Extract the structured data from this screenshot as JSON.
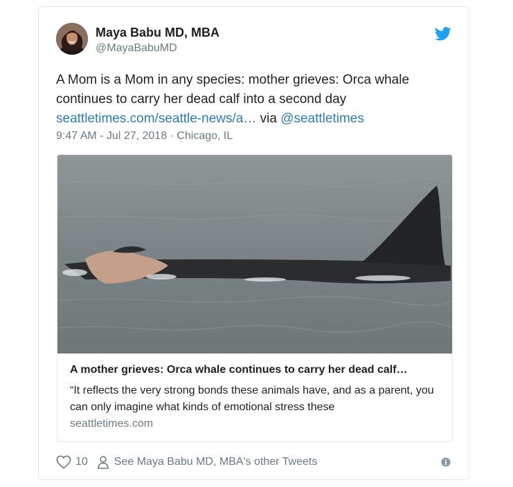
{
  "author": {
    "display_name": "Maya Babu MD, MBA",
    "handle": "@MayaBabuMD"
  },
  "tweet": {
    "text": "A Mom is a Mom in any species: mother grieves: Orca whale continues to carry her dead calf into a second day",
    "link": "seattletimes.com/seattle-news/a…",
    "via_label": "via",
    "mention": "@seattletimes",
    "timestamp": "9:47 AM - Jul 27, 2018 · Chicago, IL"
  },
  "card": {
    "title": "A mother grieves: Orca whale continues to carry her dead calf…",
    "description": "“It reflects the very strong bonds these animals have, and as a parent, you can only imagine what kinds of emotional stress these",
    "domain": "seattletimes.com"
  },
  "footer": {
    "like_count": "10",
    "see_other_label": "See Maya Babu MD, MBA's other Tweets"
  },
  "colors": {
    "link": "#2b7bb9",
    "twitter_blue": "#1da1f2",
    "secondary_text": "#697882",
    "border": "#e1e8ed"
  },
  "icons": [
    "twitter-bird-icon",
    "heart-icon",
    "person-icon",
    "info-icon"
  ]
}
